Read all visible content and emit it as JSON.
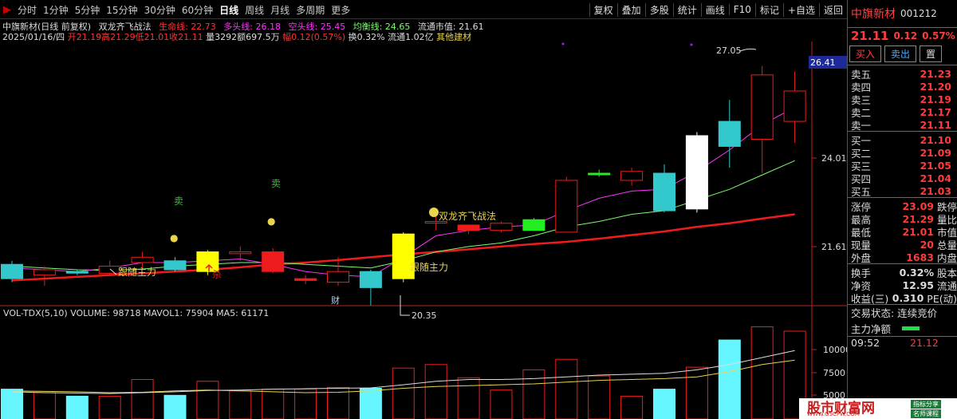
{
  "toolbar": {
    "periods": [
      "分时",
      "1分钟",
      "5分钟",
      "15分钟",
      "30分钟",
      "60分钟",
      "日线",
      "周线",
      "月线",
      "多周期",
      "更多"
    ],
    "active_period": "日线",
    "actions": [
      "复权",
      "叠加",
      "多股",
      "统计",
      "画线",
      "F10",
      "标记",
      "+自选",
      "返回"
    ]
  },
  "info": {
    "stock_title": "中旗新材(日线 前复权)",
    "formula": "双龙齐飞战法",
    "lifeline": "生命线: 22.73",
    "longline": "多头线: 26.18",
    "shortline": "空头线: 25.45",
    "balanceline": "均衡线: 24.65",
    "float_mv": "流通市值: 21.61",
    "date": "2025/01/16/四",
    "open": "开21.19",
    "high": "高21.29",
    "low": "低21.01",
    "close": "收21.11",
    "vol": "量3292",
    "amount": "额697.5万",
    "amplitude": "幅0.12(0.57%)",
    "turnover": "换0.32%",
    "float_cap": "流通1.02亿",
    "industry": "其他建材"
  },
  "price_axis": {
    "top_tag": "26.41",
    "mid": "24.01",
    "low": "21.61"
  },
  "vol_axis": [
    "10000",
    "7500",
    "5000"
  ],
  "vol_info": {
    "name": "VOL-TDX(5,10)",
    "volume": "VOLUME: 98718",
    "mavol1": "MAVOL1: 75904",
    "ma5": "MA5: 61171"
  },
  "annotations": {
    "sell1": "卖",
    "sell2": "卖",
    "follow1": "跟随主力",
    "follow2": "跟随主力",
    "kill": "杀",
    "cai": "财",
    "dragon": "双龙齐飞战法",
    "high_label": "27.05",
    "low_label": "20.35"
  },
  "panel": {
    "name": "中旗新材",
    "code": "001212",
    "price": "21.11",
    "change": "0.12",
    "pct": "0.57%",
    "buy_btn": "买入",
    "sell_btn": "卖出",
    "more_btn": "置",
    "asks": [
      {
        "label": "卖五",
        "price": "21.23"
      },
      {
        "label": "卖四",
        "price": "21.20"
      },
      {
        "label": "卖三",
        "price": "21.19"
      },
      {
        "label": "卖二",
        "price": "21.17"
      },
      {
        "label": "卖一",
        "price": "21.11"
      }
    ],
    "bids": [
      {
        "label": "买一",
        "price": "21.10"
      },
      {
        "label": "买二",
        "price": "21.09"
      },
      {
        "label": "买三",
        "price": "21.05"
      },
      {
        "label": "买四",
        "price": "21.04"
      },
      {
        "label": "买五",
        "price": "21.03"
      }
    ],
    "stats": [
      {
        "label": "涨停",
        "value": "23.09",
        "extra": "跌停"
      },
      {
        "label": "最高",
        "value": "21.29",
        "extra": "量比"
      },
      {
        "label": "最低",
        "value": "21.01",
        "extra": "市值"
      },
      {
        "label": "现量",
        "value": "20",
        "extra": "总量"
      },
      {
        "label": "外盘",
        "value": "1683",
        "extra": "内盘"
      }
    ],
    "stats2": [
      {
        "label": "换手",
        "value": "0.32%",
        "extra": "股本"
      },
      {
        "label": "净资",
        "value": "12.95",
        "extra": "流通"
      },
      {
        "label": "收益(三)",
        "value": "0.310",
        "extra": "PE(动)"
      }
    ],
    "trade_state": "交易状态: 连续竞价",
    "main_net": "主力净额",
    "time": "09:52",
    "time_price": "21.12"
  },
  "watermark": {
    "big": "股市财富网",
    "url": "WWW.GSCFW.COM",
    "tag1": "指标分享",
    "tag2": "名师课程"
  },
  "chart_data": {
    "type": "candlestick",
    "candles": [
      {
        "o": 21.5,
        "c": 21.1,
        "h": 21.6,
        "l": 21.0,
        "col": "cyan"
      },
      {
        "o": 21.2,
        "c": 21.35,
        "h": 21.45,
        "l": 20.9,
        "col": "red"
      },
      {
        "o": 21.3,
        "c": 21.27,
        "h": 21.35,
        "l": 21.2,
        "col": "cyan"
      },
      {
        "o": 21.25,
        "c": 21.45,
        "h": 21.6,
        "l": 21.2,
        "col": "red"
      },
      {
        "o": 21.55,
        "c": 21.7,
        "h": 21.85,
        "l": 21.4,
        "col": "red"
      },
      {
        "o": 21.6,
        "c": 21.35,
        "h": 21.7,
        "l": 21.3,
        "col": "cyan"
      },
      {
        "o": 21.85,
        "c": 21.3,
        "h": 21.9,
        "l": 21.2,
        "col": "yellow"
      },
      {
        "o": 21.8,
        "c": 21.85,
        "h": 22.0,
        "l": 21.6,
        "col": "red"
      },
      {
        "o": 21.3,
        "c": 21.85,
        "h": 21.95,
        "l": 21.25,
        "col": "fred"
      },
      {
        "o": 21.05,
        "c": 21.1,
        "h": 21.2,
        "l": 20.95,
        "col": "fred"
      },
      {
        "o": 21.0,
        "c": 21.3,
        "h": 21.7,
        "l": 20.9,
        "col": "red"
      },
      {
        "o": 21.3,
        "c": 20.85,
        "h": 21.35,
        "l": 20.35,
        "col": "cyan"
      },
      {
        "o": 21.1,
        "c": 22.35,
        "h": 22.4,
        "l": 21.0,
        "col": "yellow"
      },
      {
        "o": 22.7,
        "c": 22.7,
        "h": 22.95,
        "l": 22.45,
        "col": "red"
      },
      {
        "o": 22.45,
        "c": 22.6,
        "h": 22.6,
        "l": 22.35,
        "col": "fred"
      },
      {
        "o": 22.45,
        "c": 22.65,
        "h": 22.7,
        "l": 22.4,
        "col": "red"
      },
      {
        "o": 22.45,
        "c": 22.75,
        "h": 22.8,
        "l": 22.45,
        "col": "green"
      },
      {
        "o": 22.4,
        "c": 23.85,
        "h": 23.95,
        "l": 22.4,
        "col": "red"
      },
      {
        "o": 24.05,
        "c": 24.05,
        "h": 24.15,
        "l": 23.95,
        "col": "green"
      },
      {
        "o": 23.85,
        "c": 24.1,
        "h": 24.2,
        "l": 23.7,
        "col": "red"
      },
      {
        "o": 24.05,
        "c": 23.0,
        "h": 24.3,
        "l": 22.95,
        "col": "cyan"
      },
      {
        "o": 23.05,
        "c": 25.1,
        "h": 25.2,
        "l": 22.95,
        "col": "white"
      },
      {
        "o": 24.8,
        "c": 25.5,
        "h": 26.1,
        "l": 24.2,
        "col": "cyan"
      },
      {
        "o": 25.0,
        "c": 26.8,
        "h": 27.05,
        "l": 24.05,
        "col": "red"
      },
      {
        "o": 26.35,
        "c": 25.5,
        "h": 26.9,
        "l": 24.9,
        "col": "red"
      }
    ],
    "volume": [
      3400,
      3000,
      2600,
      2600,
      4500,
      2700,
      4300,
      3200,
      3400,
      3400,
      3600,
      3500,
      5800,
      6200,
      4700,
      3300,
      5600,
      6800,
      4900,
      2600,
      3400,
      5900,
      9000,
      10500,
      10000
    ],
    "ylim": [
      20.3,
      27.6
    ],
    "vol_ylim": [
      0,
      11000
    ]
  }
}
